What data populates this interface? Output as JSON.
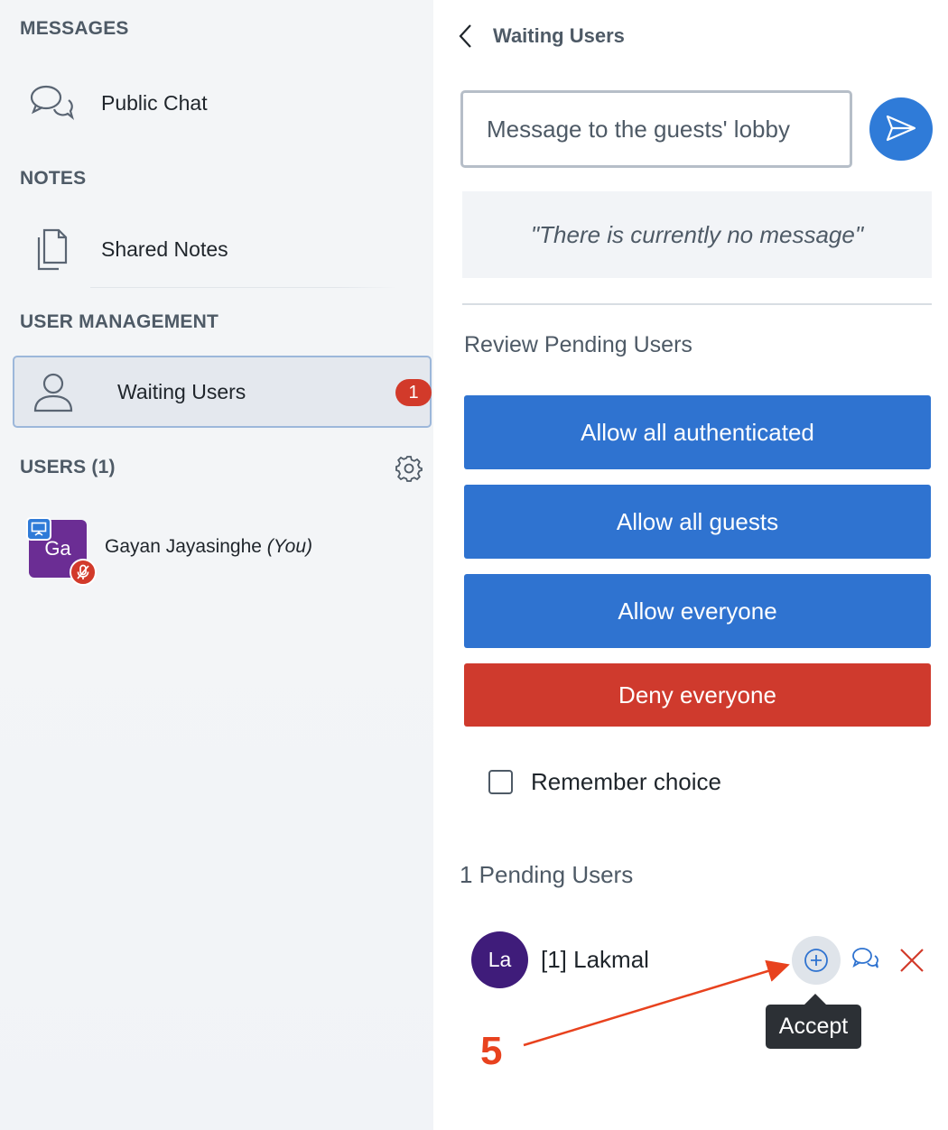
{
  "sidebar": {
    "messages_title": "MESSAGES",
    "public_chat": "Public Chat",
    "notes_title": "NOTES",
    "shared_notes": "Shared Notes",
    "user_management_title": "USER MANAGEMENT",
    "waiting_users": "Waiting Users",
    "waiting_count": "1",
    "users_title": "USERS (1)",
    "user": {
      "initials": "Ga",
      "name": "Gayan Jayasinghe",
      "you_label": "(You)",
      "avatar_color": "#6b2d94"
    }
  },
  "panel": {
    "back_icon": "chevron-left-icon",
    "title": "Waiting Users",
    "message_input_placeholder": "Message to the guests' lobby",
    "lobby_message": "\"There is currently no message\"",
    "review_title": "Review Pending Users",
    "buttons": {
      "allow_authenticated": "Allow all authenticated",
      "allow_guests": "Allow all guests",
      "allow_everyone": "Allow everyone",
      "deny_everyone": "Deny everyone"
    },
    "remember_choice": "Remember choice",
    "remember_checked": false,
    "pending_title": "1 Pending Users",
    "pending_users": [
      {
        "initials": "La",
        "name": "[1] Lakmal",
        "avatar_color": "#3f1c7a"
      }
    ],
    "tooltip": "Accept"
  },
  "annotation": {
    "step": "5",
    "color": "#e8421e"
  },
  "colors": {
    "accent": "#2f73d0",
    "danger": "#cf3a2d",
    "sidebar_bg": "#f3f5f7"
  }
}
